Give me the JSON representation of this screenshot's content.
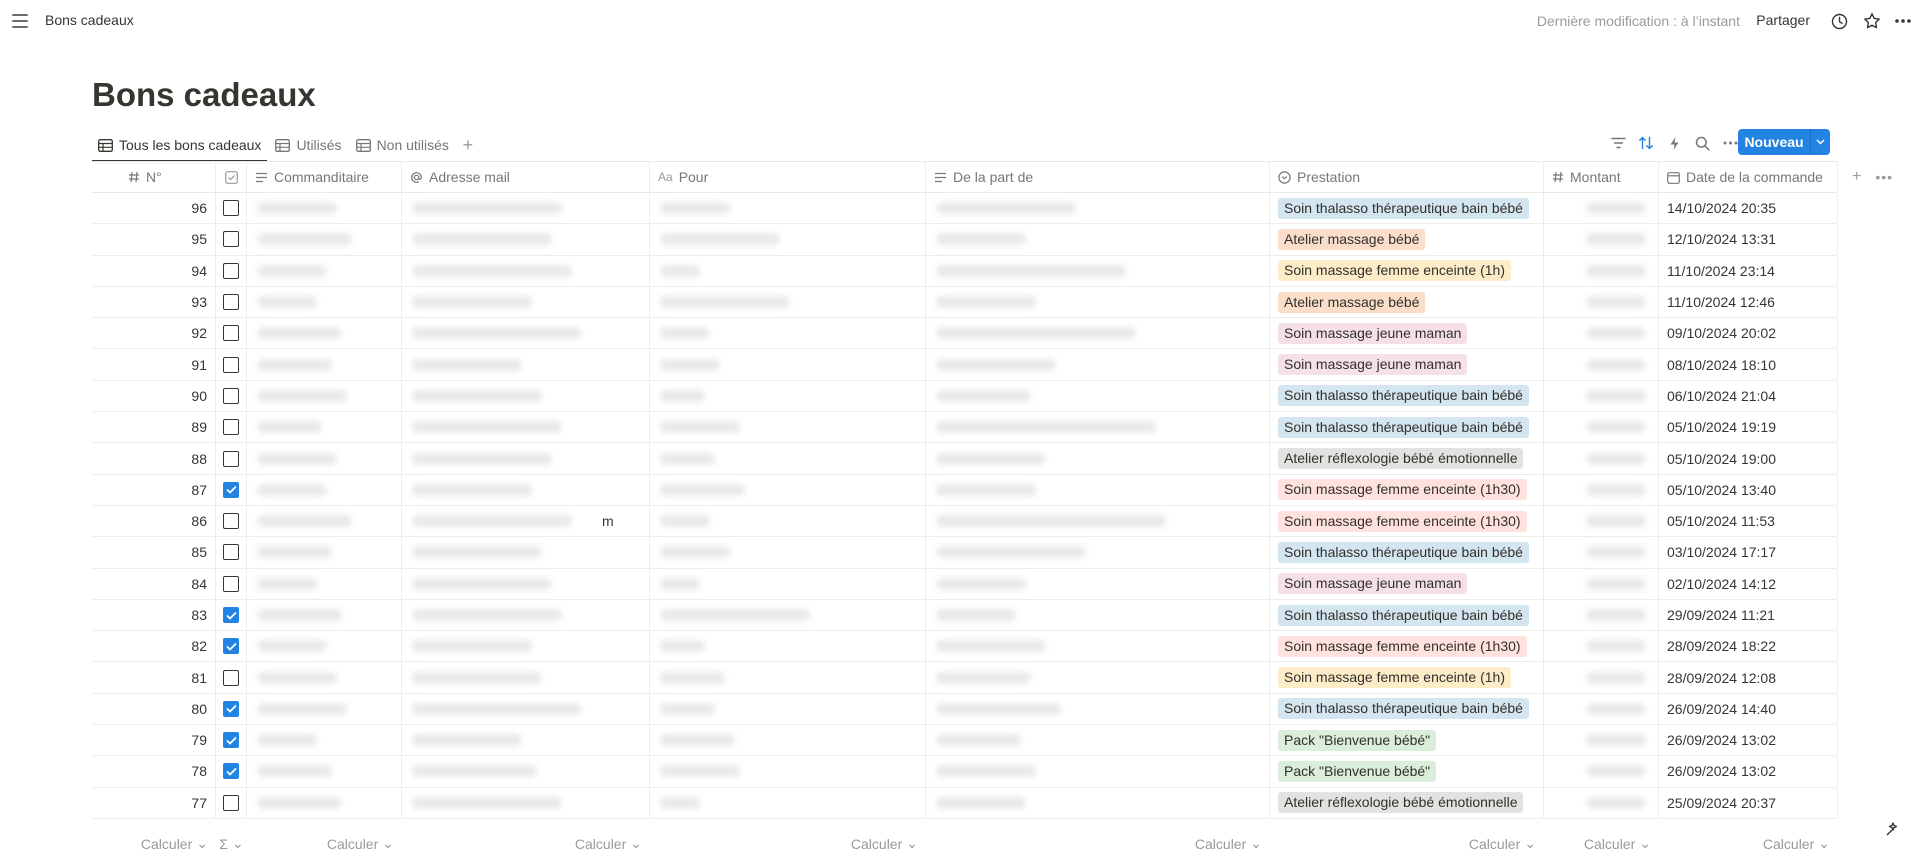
{
  "topbar": {
    "breadcrumb": "Bons cadeaux",
    "last_edit": "Dernière modification : à l’instant",
    "share_label": "Partager"
  },
  "page": {
    "title": "Bons cadeaux"
  },
  "views": [
    {
      "label": "Tous les bons cadeaux",
      "active": true
    },
    {
      "label": "Utilisés",
      "active": false
    },
    {
      "label": "Non utilisés",
      "active": false
    }
  ],
  "toolbar": {
    "new_label": "Nouveau",
    "accent": "#2383e2"
  },
  "columns": {
    "num": "N°",
    "commanditaire": "Commanditaire",
    "mail": "Adresse mail",
    "pour": "Pour",
    "part": "De la part de",
    "prestation": "Prestation",
    "montant": "Montant",
    "date": "Date de la commande"
  },
  "tag_colors": {
    "Soin thalasso thérapeutique bain bébé": "#d3e5ef",
    "Atelier massage bébé": "#fadec9",
    "Soin massage femme enceinte (1h)": "#fdecc8",
    "Soin massage jeune maman": "#f5e0e9",
    "Atelier réflexologie bébé émotionnelle": "#e3e2e0",
    "Soin massage femme enceinte (1h30)": "#ffe2dd",
    "Pack \"Bienvenue bébé\"": "#dbeddb"
  },
  "rows": [
    {
      "num": "96",
      "checked": false,
      "prestation": "Soin thalasso thérapeutique bain bébé",
      "date": "14/10/2024 20:35"
    },
    {
      "num": "95",
      "checked": false,
      "prestation": "Atelier massage bébé",
      "date": "12/10/2024 13:31"
    },
    {
      "num": "94",
      "checked": false,
      "prestation": "Soin massage femme enceinte (1h)",
      "date": "11/10/2024 23:14"
    },
    {
      "num": "93",
      "checked": false,
      "prestation": "Atelier massage bébé",
      "date": "11/10/2024 12:46"
    },
    {
      "num": "92",
      "checked": false,
      "prestation": "Soin massage jeune maman",
      "date": "09/10/2024 20:02"
    },
    {
      "num": "91",
      "checked": false,
      "prestation": "Soin massage jeune maman",
      "date": "08/10/2024 18:10"
    },
    {
      "num": "90",
      "checked": false,
      "prestation": "Soin thalasso thérapeutique bain bébé",
      "date": "06/10/2024 21:04"
    },
    {
      "num": "89",
      "checked": false,
      "prestation": "Soin thalasso thérapeutique bain bébé",
      "date": "05/10/2024 19:19"
    },
    {
      "num": "88",
      "checked": false,
      "prestation": "Atelier réflexologie bébé émotionnelle",
      "date": "05/10/2024 19:00"
    },
    {
      "num": "87",
      "checked": true,
      "prestation": "Soin massage femme enceinte (1h30)",
      "date": "05/10/2024 13:40"
    },
    {
      "num": "86",
      "checked": false,
      "prestation": "Soin massage femme enceinte (1h30)",
      "date": "05/10/2024 11:53",
      "mail_tail": "m"
    },
    {
      "num": "85",
      "checked": false,
      "prestation": "Soin thalasso thérapeutique bain bébé",
      "date": "03/10/2024 17:17"
    },
    {
      "num": "84",
      "checked": false,
      "prestation": "Soin massage jeune maman",
      "date": "02/10/2024 14:12"
    },
    {
      "num": "83",
      "checked": true,
      "prestation": "Soin thalasso thérapeutique bain bébé",
      "date": "29/09/2024 11:21"
    },
    {
      "num": "82",
      "checked": true,
      "prestation": "Soin massage femme enceinte (1h30)",
      "date": "28/09/2024 18:22"
    },
    {
      "num": "81",
      "checked": false,
      "prestation": "Soin massage femme enceinte (1h)",
      "date": "28/09/2024 12:08"
    },
    {
      "num": "80",
      "checked": true,
      "prestation": "Soin thalasso thérapeutique bain bébé",
      "date": "26/09/2024 14:40"
    },
    {
      "num": "79",
      "checked": true,
      "prestation": "Pack \"Bienvenue bébé\"",
      "date": "26/09/2024 13:02"
    },
    {
      "num": "78",
      "checked": true,
      "prestation": "Pack \"Bienvenue bébé\"",
      "date": "26/09/2024 13:02"
    },
    {
      "num": "77",
      "checked": false,
      "prestation": "Atelier réflexologie bébé émotionnelle",
      "date": "25/09/2024 20:37"
    }
  ],
  "footer": {
    "calc_label": "Calculer",
    "sigma": "Σ"
  }
}
